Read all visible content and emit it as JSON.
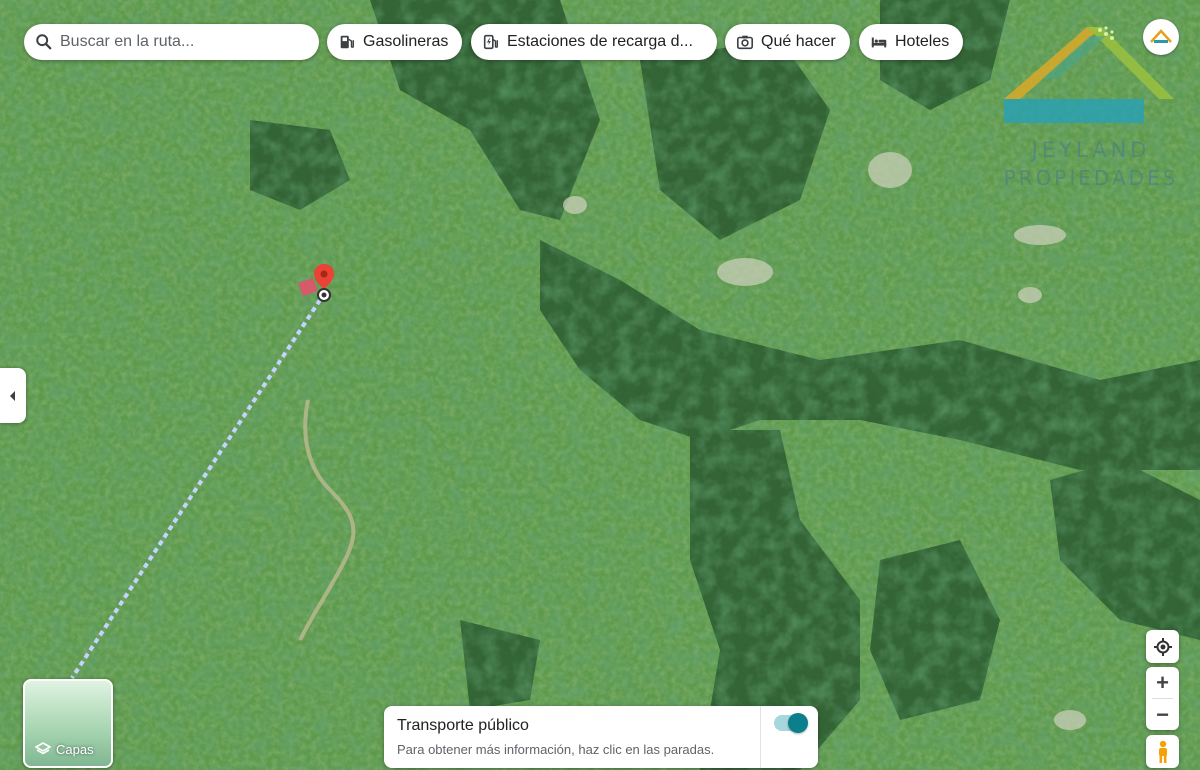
{
  "search": {
    "placeholder": "Buscar en la ruta..."
  },
  "chips": {
    "gas": "Gasolineras",
    "ev": "Estaciones de recarga d...",
    "things": "Qué hacer",
    "hotels": "Hoteles"
  },
  "watermark": {
    "line1": "JEYLAND",
    "line2": "PROPIEDADES"
  },
  "layers": {
    "label": "Capas"
  },
  "transit": {
    "title": "Transporte público",
    "subtitle": "Para obtener más información, haz clic en las paradas.",
    "toggle_on": true
  },
  "zoom": {
    "in": "+",
    "out": "−"
  },
  "icons": {
    "search": "search-icon",
    "gas": "gas-pump-icon",
    "ev": "ev-charger-icon",
    "things": "camera-icon",
    "hotels": "bed-icon",
    "layers": "layers-icon",
    "locate": "my-location-icon",
    "peg": "pegman-icon",
    "collapse": "chevron-left-icon",
    "pin": "map-pin-icon"
  },
  "colors": {
    "accent": "#0b7f8c",
    "pin": "#ea4335",
    "route": "#b7c8ff"
  }
}
